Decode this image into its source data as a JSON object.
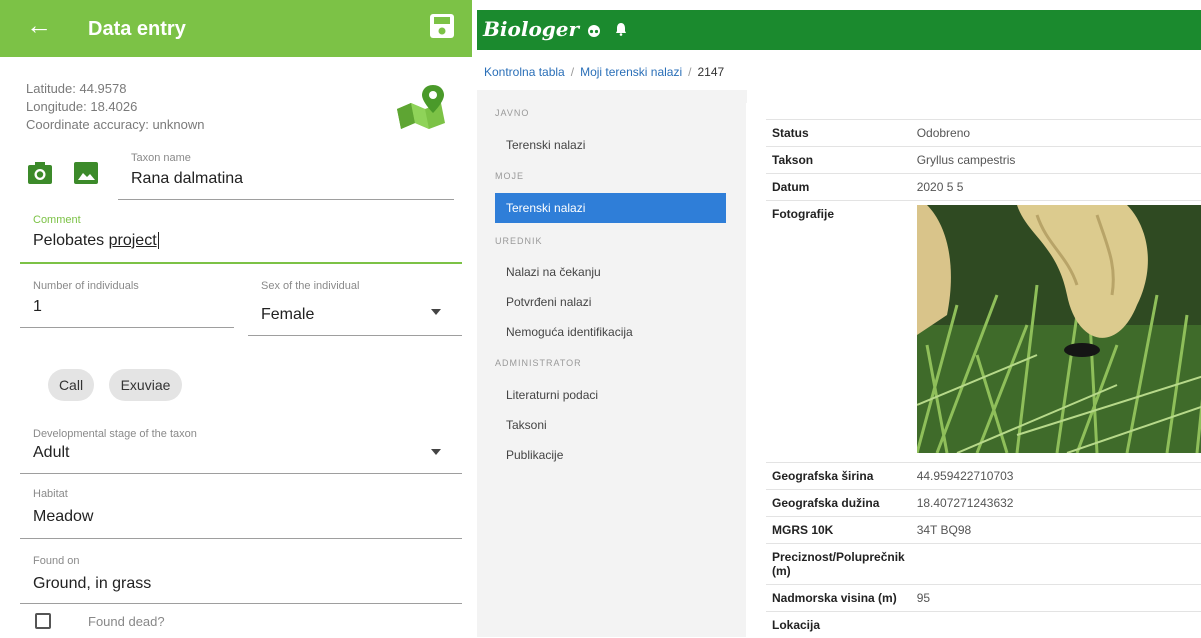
{
  "left": {
    "appbar": {
      "title": "Data entry"
    },
    "coords": {
      "latitude": "Latitude:  44.9578",
      "longitude": "Longitude:  18.4026",
      "accuracy": "Coordinate accuracy:  unknown"
    },
    "taxon": {
      "label": "Taxon name",
      "value": "Rana dalmatina"
    },
    "comment": {
      "label": "Comment",
      "value_a": "Pelobates ",
      "value_b": "project"
    },
    "individuals": {
      "label": "Number of individuals",
      "value": "1"
    },
    "sex": {
      "label": "Sex of the individual",
      "value": "Female"
    },
    "chips": [
      "Call",
      "Exuviae"
    ],
    "stage": {
      "label": "Developmental stage of the taxon",
      "value": "Adult"
    },
    "habitat": {
      "label": "Habitat",
      "value": "Meadow"
    },
    "found_on": {
      "label": "Found on",
      "value": "Ground, in grass"
    },
    "found_dead": {
      "label": "Found dead?"
    },
    "colors": {
      "accent": "#7cc246"
    }
  },
  "right": {
    "header": {
      "logo": "Biologer"
    },
    "breadcrumb": {
      "home": "Kontrolna tabla",
      "mine": "Moji terenski nalazi",
      "current": "2147"
    },
    "sidebar": {
      "sec_public": "JAVNO",
      "public_items": [
        "Terenski nalazi"
      ],
      "sec_mine": "MOJE",
      "mine_active": "Terenski nalazi",
      "sec_editor": "UREDNIK",
      "editor_items": [
        "Nalazi na čekanju",
        "Potvrđeni nalazi",
        "Nemoguća identifikacija"
      ],
      "sec_admin": "ADMINISTRATOR",
      "admin_items": [
        "Literaturni podaci",
        "Taksoni",
        "Publikacije"
      ]
    },
    "detail": {
      "rows": [
        {
          "k": "Status",
          "v": "Odobreno"
        },
        {
          "k": "Takson",
          "v": "Gryllus campestris"
        },
        {
          "k": "Datum",
          "v": "2020 5 5"
        },
        {
          "k": "Fotografije",
          "v": ""
        },
        {
          "k": "Geografska širina",
          "v": "44.959422710703"
        },
        {
          "k": "Geografska dužina",
          "v": "18.407271243632"
        },
        {
          "k": "MGRS 10K",
          "v": "34T BQ98"
        },
        {
          "k": "Preciznost/Poluprečnik (m)",
          "v": ""
        },
        {
          "k": "Nadmorska visina (m)",
          "v": "95"
        },
        {
          "k": "Lokacija",
          "v": ""
        }
      ]
    },
    "colors": {
      "header": "#1b8a2e",
      "active": "#2f7ed8"
    }
  }
}
